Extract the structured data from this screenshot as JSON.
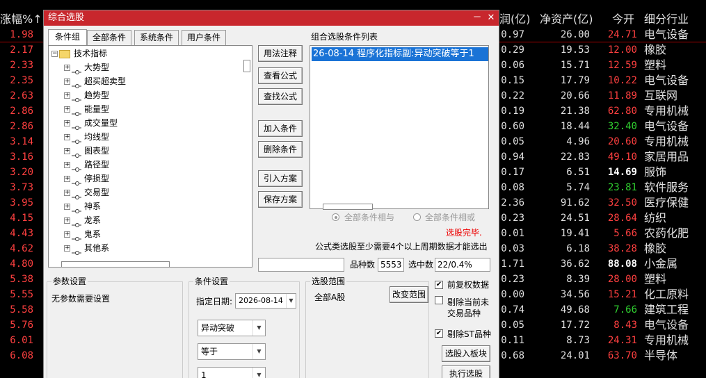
{
  "background": {
    "headers": {
      "change_pct": "涨幅%↑",
      "profit": "润(亿)",
      "net_assets": "净资产(亿)",
      "open": "今开",
      "industry": "细分行业"
    },
    "rows": [
      {
        "chg": "1.98",
        "profit": "0.97",
        "assets": "26.00",
        "open": "24.71",
        "open_color": "#ff4040",
        "ind": "电气设备"
      },
      {
        "chg": "2.17",
        "profit": "-0.29",
        "assets": "19.53",
        "open": "12.00",
        "open_color": "#ff4040",
        "ind": "橡胶"
      },
      {
        "chg": "2.33",
        "profit": "0.06",
        "assets": "15.71",
        "open": "12.59",
        "open_color": "#ff4040",
        "ind": "塑料"
      },
      {
        "chg": "2.35",
        "profit": "0.15",
        "assets": "17.79",
        "open": "10.22",
        "open_color": "#ff4040",
        "ind": "电气设备"
      },
      {
        "chg": "2.63",
        "profit": "0.22",
        "assets": "20.66",
        "open": "11.89",
        "open_color": "#ff4040",
        "ind": "互联网"
      },
      {
        "chg": "2.86",
        "profit": "0.19",
        "assets": "21.38",
        "open": "62.80",
        "open_color": "#ff4040",
        "ind": "专用机械"
      },
      {
        "chg": "2.86",
        "profit": "0.60",
        "assets": "18.44",
        "open": "32.40",
        "open_color": "#30d030",
        "ind": "电气设备"
      },
      {
        "chg": "3.14",
        "profit": "-0.05",
        "assets": "4.96",
        "open": "20.60",
        "open_color": "#ff4040",
        "ind": "专用机械"
      },
      {
        "chg": "3.16",
        "profit": "0.94",
        "assets": "22.83",
        "open": "49.10",
        "open_color": "#ff4040",
        "ind": "家居用品"
      },
      {
        "chg": "3.20",
        "profit": "0.17",
        "assets": "6.51",
        "open": "14.69",
        "open_color": "#ffffff",
        "ind": "服饰"
      },
      {
        "chg": "3.73",
        "profit": "-0.08",
        "assets": "5.74",
        "open": "23.81",
        "open_color": "#30d030",
        "ind": "软件服务"
      },
      {
        "chg": "3.95",
        "profit": "2.36",
        "assets": "91.62",
        "open": "32.50",
        "open_color": "#ff4040",
        "ind": "医疗保健"
      },
      {
        "chg": "4.15",
        "profit": "0.23",
        "assets": "24.51",
        "open": "28.64",
        "open_color": "#ff4040",
        "ind": "纺织"
      },
      {
        "chg": "4.43",
        "profit": "0.01",
        "assets": "19.41",
        "open": "5.66",
        "open_color": "#ff4040",
        "ind": "农药化肥"
      },
      {
        "chg": "4.62",
        "profit": "-0.03",
        "assets": "6.18",
        "open": "38.28",
        "open_color": "#ff4040",
        "ind": "橡胶"
      },
      {
        "chg": "4.80",
        "profit": "1.71",
        "assets": "36.62",
        "open": "88.08",
        "open_color": "#ffffff",
        "ind": "小金属"
      },
      {
        "chg": "5.38",
        "profit": "-0.23",
        "assets": "8.39",
        "open": "28.00",
        "open_color": "#ff4040",
        "ind": "塑料"
      },
      {
        "chg": "5.55",
        "profit": "0.00",
        "assets": "34.56",
        "open": "15.21",
        "open_color": "#ff4040",
        "ind": "化工原料"
      },
      {
        "chg": "5.58",
        "profit": "0.74",
        "assets": "49.68",
        "open": "7.66",
        "open_color": "#30d030",
        "ind": "建筑工程"
      },
      {
        "chg": "5.76",
        "profit": "-0.05",
        "assets": "17.72",
        "open": "8.43",
        "open_color": "#ff4040",
        "ind": "电气设备"
      },
      {
        "chg": "6.01",
        "profit": "0.11",
        "assets": "8.73",
        "open": "24.31",
        "open_color": "#ff4040",
        "ind": "专用机械"
      },
      {
        "chg": "6.08",
        "profit": "0.68",
        "assets": "24.01",
        "open": "63.70",
        "open_color": "#ff4040",
        "ind": "半导体"
      }
    ]
  },
  "dialog": {
    "title": "综合选股",
    "minimize": "－",
    "close": "✕",
    "tabs": [
      "条件组",
      "全部条件",
      "系统条件",
      "用户条件"
    ],
    "tree": {
      "root": "技术指标",
      "items": [
        "大势型",
        "超买超卖型",
        "趋势型",
        "能量型",
        "成交量型",
        "均线型",
        "图表型",
        "路径型",
        "停损型",
        "交易型",
        "神系",
        "龙系",
        "鬼系",
        "其他系"
      ]
    },
    "buttons": {
      "usage": "用法注释",
      "view": "查看公式",
      "find": "查找公式",
      "add": "加入条件",
      "delete": "删除条件",
      "import": "引入方案",
      "save": "保存方案"
    },
    "cond_list_label": "组合选股条件列表",
    "cond_items": [
      "26-08-14 程序化指标副:异动突破等于1"
    ],
    "radio_and": "全部条件相与",
    "radio_or": "全部条件相或",
    "status": "选股完毕.",
    "note": "公式类选股至少需要4个以上周期数据才能选出",
    "count_label": "品种数",
    "count_value": "5553",
    "selected_label": "选中数",
    "selected_value": "22/0.4%",
    "params": {
      "title": "参数设置",
      "text": "无参数需要设置"
    },
    "cond_settings": {
      "title": "条件设置",
      "date_label": "指定日期:",
      "date_value": "2026-08-14",
      "combo1": "异动突破",
      "combo2": "等于",
      "combo3": "1"
    },
    "range": {
      "title": "选股范围",
      "value": "全部A股",
      "change_btn": "改变范围"
    },
    "options": {
      "adjust": "前复权数据",
      "exclude_untraded_1": "剔除当前未",
      "exclude_untraded_2": "交易品种",
      "exclude_st": "剔除ST品种",
      "to_block": "选股入板块",
      "run": "执行选股"
    }
  }
}
